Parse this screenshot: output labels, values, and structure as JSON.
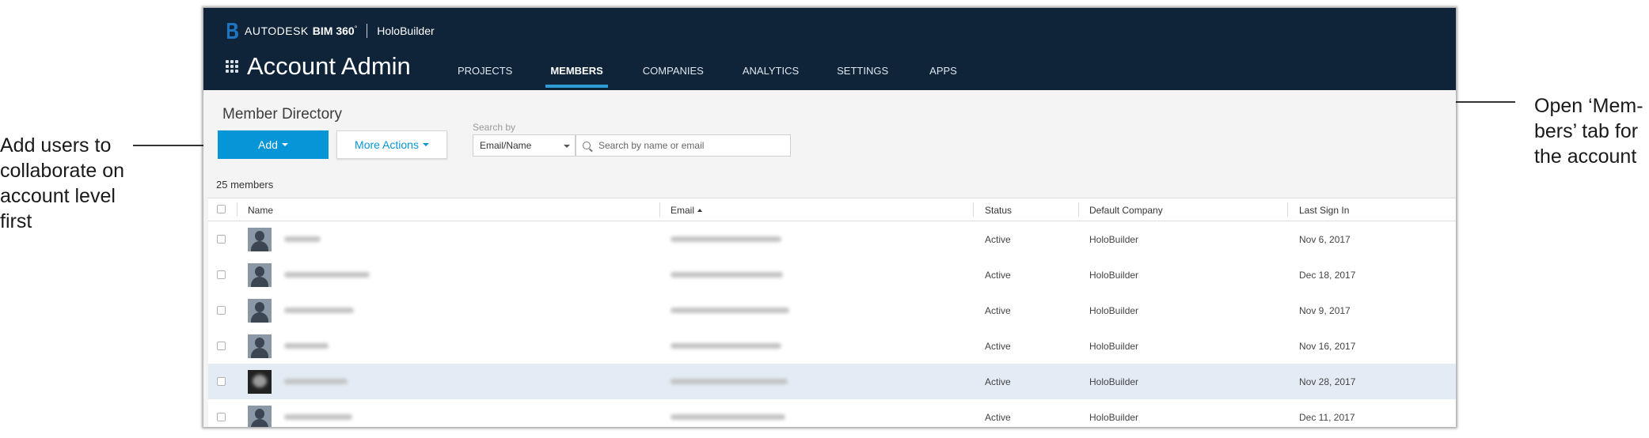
{
  "annotations": {
    "left_lines": [
      "Add users to",
      "collaborate on",
      "account level",
      "first"
    ],
    "right_lines": [
      "Open ‘Mem-",
      "bers’ tab for",
      "the account"
    ]
  },
  "header": {
    "brand_autodesk": "AUTODESK",
    "brand_product": "BIM 360",
    "brand_product_mark": "°",
    "account_name": "HoloBuilder",
    "app_title": "Account Admin",
    "tabs": [
      {
        "label": "PROJECTS",
        "active": false
      },
      {
        "label": "MEMBERS",
        "active": true
      },
      {
        "label": "COMPANIES",
        "active": false
      },
      {
        "label": "ANALYTICS",
        "active": false
      },
      {
        "label": "SETTINGS",
        "active": false
      },
      {
        "label": "APPS",
        "active": false
      }
    ]
  },
  "toolbar": {
    "section_title": "Member Directory",
    "add_label": "Add",
    "more_actions_label": "More Actions",
    "search_by_label": "Search by",
    "search_by_value": "Email/Name",
    "search_placeholder": "Search by name or email",
    "member_count": "25 members"
  },
  "table": {
    "columns": [
      "Name",
      "Email",
      "Status",
      "Default Company",
      "Last Sign In"
    ],
    "sorted_column": "Email",
    "rows": [
      {
        "status": "Active",
        "company": "HoloBuilder",
        "last_sign_in": "Nov 6, 2017",
        "highlight": false,
        "avatar": "default"
      },
      {
        "status": "Active",
        "company": "HoloBuilder",
        "last_sign_in": "Dec 18, 2017",
        "highlight": false,
        "avatar": "default"
      },
      {
        "status": "Active",
        "company": "HoloBuilder",
        "last_sign_in": "Nov 9, 2017",
        "highlight": false,
        "avatar": "default"
      },
      {
        "status": "Active",
        "company": "HoloBuilder",
        "last_sign_in": "Nov 16, 2017",
        "highlight": false,
        "avatar": "default"
      },
      {
        "status": "Active",
        "company": "HoloBuilder",
        "last_sign_in": "Nov 28, 2017",
        "highlight": true,
        "avatar": "photo"
      },
      {
        "status": "Active",
        "company": "HoloBuilder",
        "last_sign_in": "Dec 11, 2017",
        "highlight": false,
        "avatar": "default"
      }
    ]
  },
  "colors": {
    "header_bg": "#0f2339",
    "accent": "#0696d7",
    "tab_underline": "#2e9bd6",
    "row_highlight": "#e3ecf4"
  },
  "icons": [
    "autodesk-logo-icon",
    "app-grid-icon",
    "caret-down-icon",
    "search-icon",
    "sort-ascending-icon",
    "user-avatar-icon",
    "mouse-cursor-icon"
  ]
}
